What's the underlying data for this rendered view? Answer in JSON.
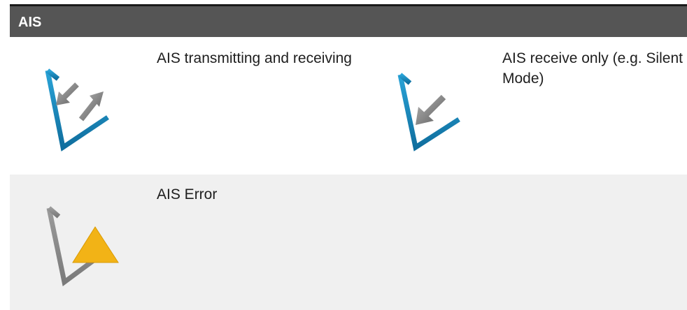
{
  "section": {
    "title": "AIS"
  },
  "rows": [
    {
      "cells": [
        {
          "icon": "ais-transmit-receive-icon",
          "description": "AIS transmitting and receiving"
        },
        {
          "icon": "ais-receive-only-icon",
          "description": "AIS receive only (e.g. Silent Mode)"
        }
      ]
    },
    {
      "cells": [
        {
          "icon": "ais-error-icon",
          "description": "AIS Error"
        }
      ]
    }
  ],
  "colors": {
    "header_background": "#555555",
    "header_text": "#ffffff",
    "row_alt_background": "#f0f0f0",
    "icon_blue": "#1a8bc0",
    "icon_grey": "#8c8c8c",
    "warning_amber": "#f2b316"
  }
}
